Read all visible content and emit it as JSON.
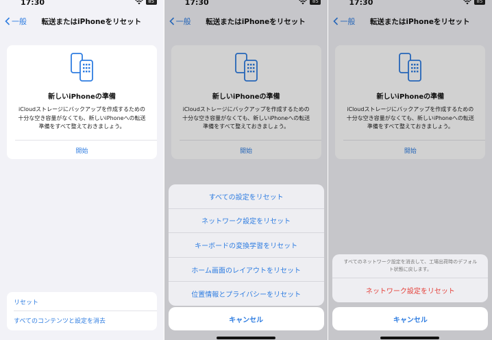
{
  "status": {
    "time": "17:30",
    "battery": "85"
  },
  "nav": {
    "back_label": "一般",
    "title": "転送またはiPhoneをリセット"
  },
  "card": {
    "title": "新しいiPhoneの準備",
    "text": "iCloudストレージにバックアップを作成するための十分な空き容量がなくても、新しいiPhoneへの転送準備をすべて整えておきましょう。",
    "start_label": "開始"
  },
  "bottom": {
    "reset_label": "リセット",
    "erase_label": "すべてのコンテンツと設定を消去"
  },
  "reset_sheet": {
    "options": [
      "すべての設定をリセット",
      "ネットワーク設定をリセット",
      "キーボードの変換学習をリセット",
      "ホーム画面のレイアウトをリセット",
      "位置情報とプライバシーをリセット"
    ],
    "cancel_label": "キャンセル"
  },
  "confirm_sheet": {
    "message": "すべてのネットワーク設定を消去して、工場出荷時のデフォルト状態に戻します。",
    "confirm_label": "ネットワーク設定をリセット",
    "cancel_label": "キャンセル"
  },
  "colors": {
    "accent": "#2f7de1",
    "destructive": "#e5413b",
    "background": "#f2f2f7"
  }
}
